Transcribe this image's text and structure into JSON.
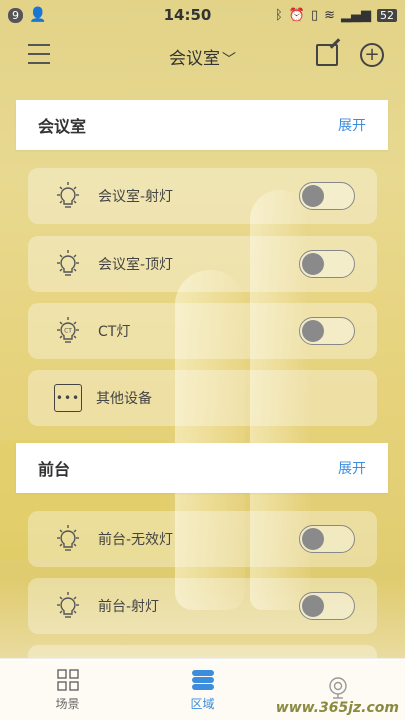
{
  "status_bar": {
    "badge": "9",
    "time": "14:50",
    "battery": "52"
  },
  "header": {
    "title": "会议室",
    "menu_icon": "hamburger-menu-icon",
    "edit_icon": "edit-icon",
    "add_icon": "plus-circle-icon"
  },
  "sections": [
    {
      "title": "会议室",
      "expand_label": "展开",
      "devices": [
        {
          "label": "会议室-射灯",
          "icon": "bulb-icon",
          "state": "off"
        },
        {
          "label": "会议室-顶灯",
          "icon": "bulb-icon",
          "state": "off"
        },
        {
          "label": "CT灯",
          "icon": "ct-bulb-icon",
          "icon_text": "CT",
          "state": "off"
        },
        {
          "label": "其他设备",
          "icon": "more-devices-icon"
        }
      ]
    },
    {
      "title": "前台",
      "expand_label": "展开",
      "devices": [
        {
          "label": "前台-无效灯",
          "icon": "bulb-icon",
          "state": "off"
        },
        {
          "label": "前台-射灯",
          "icon": "bulb-icon",
          "state": "off"
        }
      ]
    }
  ],
  "bottom_nav": [
    {
      "label": "场景",
      "icon": "grid-icon",
      "active": false
    },
    {
      "label": "区域",
      "icon": "layers-icon",
      "active": true
    },
    {
      "label": "",
      "icon": "camera-icon",
      "active": false
    }
  ],
  "watermark": "www.365jz.com",
  "colors": {
    "accent": "#3d8ddf",
    "background": "#e6d27a"
  }
}
